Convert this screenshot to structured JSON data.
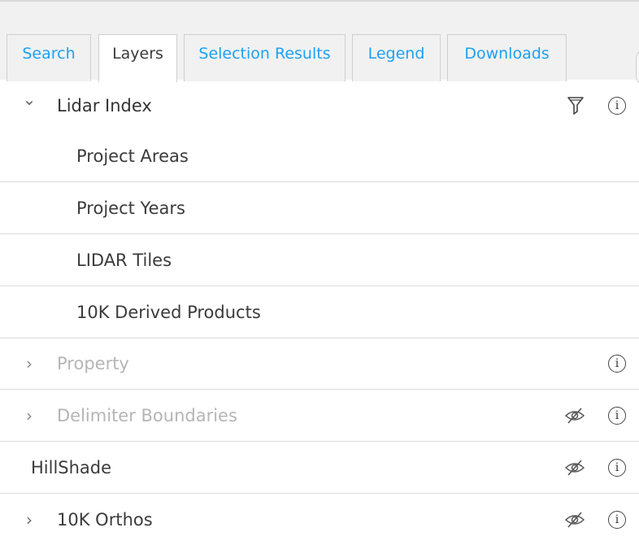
{
  "tabs": [
    {
      "label": "Search",
      "active": false
    },
    {
      "label": "Layers",
      "active": true
    },
    {
      "label": "Selection Results",
      "active": false
    },
    {
      "label": "Legend",
      "active": false
    },
    {
      "label": "Downloads",
      "active": false
    }
  ],
  "layers": {
    "lidar_index": {
      "label": "Lidar Index",
      "expanded": true,
      "children": [
        "Project Areas",
        "Project Years",
        "LIDAR Tiles",
        "10K Derived Products"
      ]
    },
    "property": {
      "label": "Property",
      "expanded": false
    },
    "delimiter": {
      "label": "Delimiter Boundaries",
      "expanded": false
    },
    "hillshade": {
      "label": "HillShade"
    },
    "orthos": {
      "label": "10K Orthos",
      "expanded": false
    }
  },
  "icons": {
    "expand_open": "chevron-down-icon",
    "expand_closed": "chevron-right-icon",
    "filter": "filter-icon",
    "info": "info-icon",
    "hidden": "eye-slash-icon"
  },
  "colors": {
    "tab_text": "#1da1f2",
    "active_tab_text": "#3b3b3b",
    "disabled_text": "#b5b5b5",
    "tabbar_bg": "#f1f1f1"
  },
  "glyphs": {
    "chevron_down": "⌄",
    "chevron_right": "›",
    "info": "i"
  }
}
